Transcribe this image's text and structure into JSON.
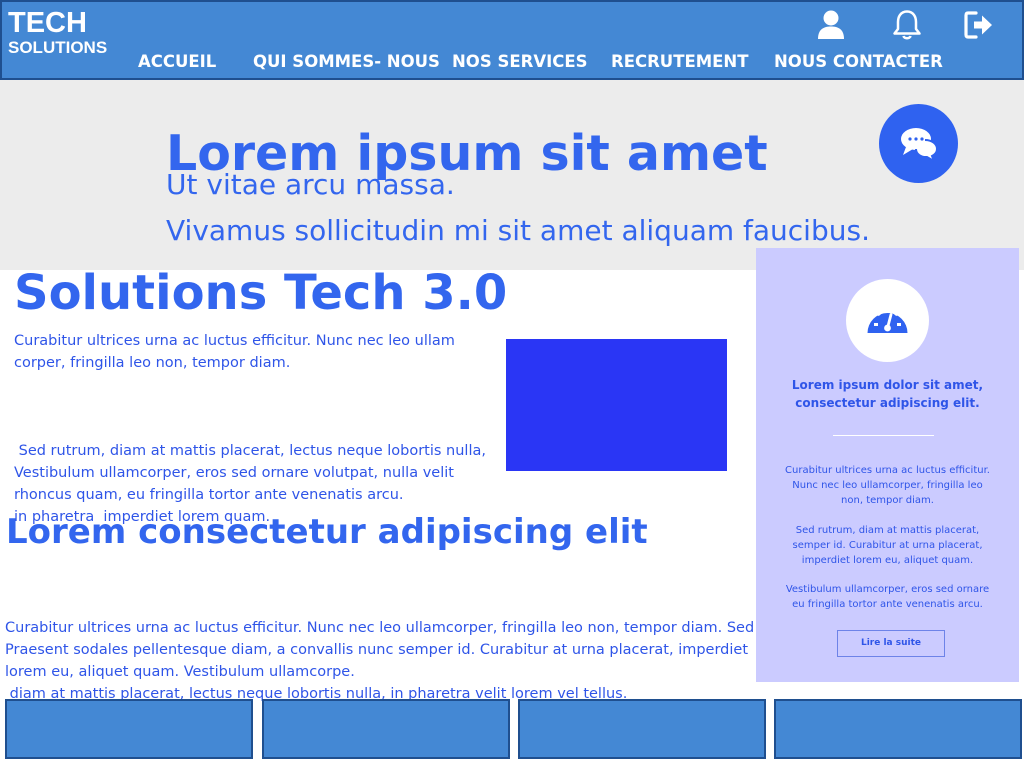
{
  "header": {
    "logo_line1": "TECH",
    "logo_line2": "SOLUTIONS",
    "nav": [
      "ACCUEIL",
      "QUI SOMMES- NOUS",
      "NOS SERVICES",
      "RECRUTEMENT",
      "NOUS CONTACTER"
    ],
    "icons": [
      "user-icon",
      "bell-icon",
      "logout-icon"
    ]
  },
  "hero": {
    "title": "Lorem ipsum sit amet",
    "line1": "Ut vitae arcu massa.",
    "line2": "Vivamus sollicitudin mi sit amet aliquam faucibus.",
    "chat_icon": "chat-bubbles-icon"
  },
  "main": {
    "title": "Solutions Tech 3.0",
    "para1_l1": "Curabitur ultrices urna ac luctus efficitur. Nunc nec leo ullam",
    "para1_l2": "corper, fringilla leo non, tempor diam.",
    "para2_l1": " Sed rutrum, diam at mattis placerat, lectus neque lobortis nulla,",
    "para2_l2": "in pharetra  imperdiet lorem quam.",
    "para3_l1": "Vestibulum ullamcorper, eros sed ornare volutpat, nulla velit",
    "para3_l2": "rhoncus quam, eu fringilla tortor ante venenatis arcu.",
    "section_title": "Lorem consectetur adipiscing elit",
    "para4_l1": "Curabitur ultrices urna ac luctus efficitur. Nunc nec leo ullamcorper, fringilla leo non, tempor diam. Sed ,",
    "para4_l2": " diam at mattis placerat, lectus neque lobortis nulla, in pharetra velit lorem vel tellus.",
    "para5_l1": "Praesent sodales pellentesque diam, a convallis nunc semper id. Curabitur at urna placerat, imperdiet",
    "para5_l2": "lorem eu, aliquet quam. Vestibulum ullamcorpe."
  },
  "sidebar": {
    "icon": "speedometer-icon",
    "heading_l1": "Lorem ipsum dolor sit amet,",
    "heading_l2": "consectetur adipiscing elit.",
    "t1_l1": "Curabitur ultrices urna ac luctus efficitur.",
    "t1_l2": "Nunc nec leo ullamcorper, fringilla leo",
    "t1_l3": "non, tempor diam.",
    "t2_l1": "Sed rutrum, diam at mattis placerat,",
    "t2_l2": "semper id. Curabitur at urna placerat,",
    "t2_l3": "imperdiet lorem eu, aliquet quam.",
    "t3_l1": "Vestibulum ullamcorper, eros sed ornare",
    "t3_l2": "eu fringilla tortor ante venenatis arcu.",
    "button_label": "Lire la suite"
  },
  "colors": {
    "header_blue": "#4488d4",
    "text_blue": "#3366ee",
    "box_blue": "#2a36f5",
    "sidebar_lilac": "#cbcbff",
    "hero_gray": "#ececec"
  }
}
